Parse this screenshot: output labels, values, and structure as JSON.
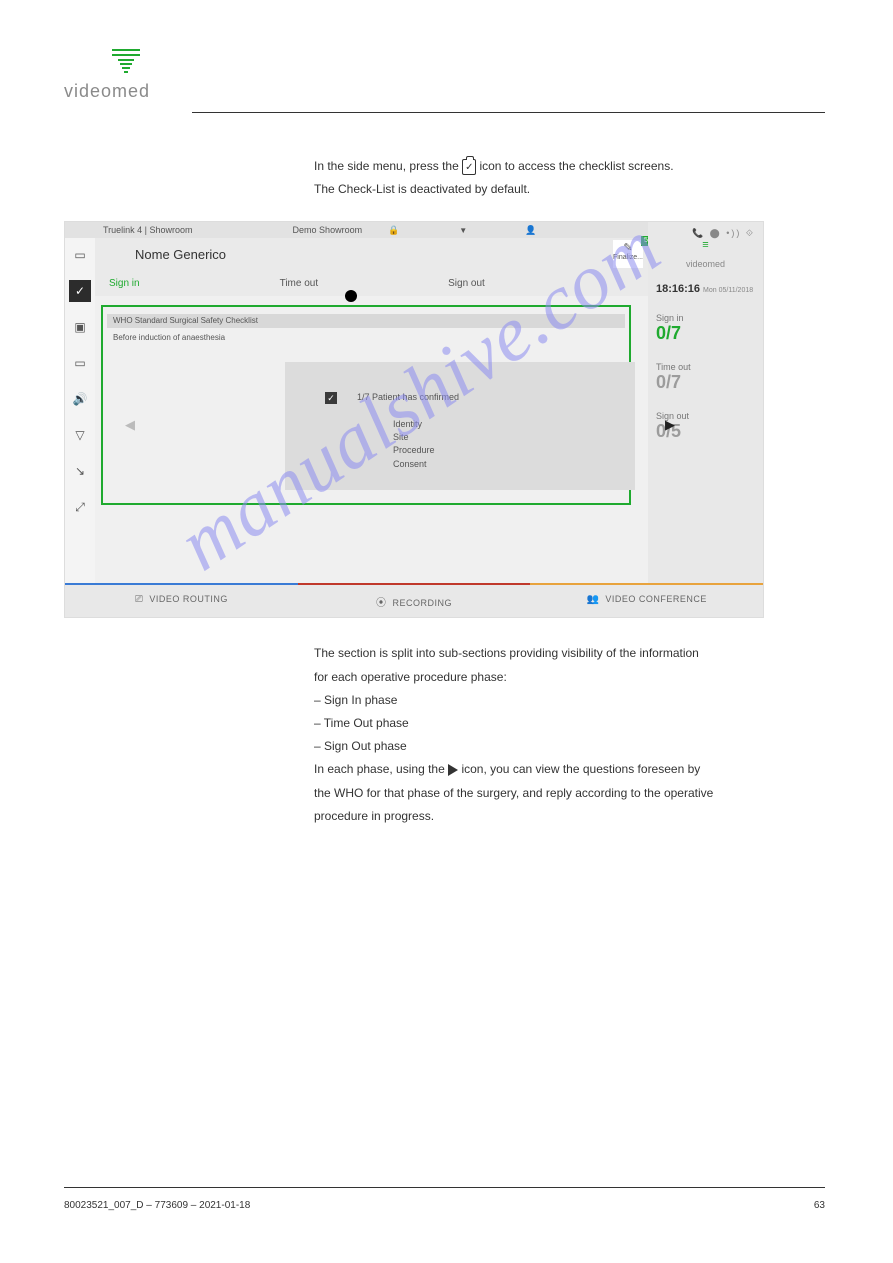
{
  "brand": "videomed",
  "intro": {
    "line1_a": "In the side menu, press the",
    "line1_b": "icon to access the checklist screens.",
    "line2": "The Check-List is deactivated by default."
  },
  "ui": {
    "top_bar": {
      "product": "Truelink 4 | Showroom",
      "demo": "Demo Showroom"
    },
    "patient_name": "Nome Generico",
    "finalize": "Finalize...",
    "finalize_badge": "5",
    "right": {
      "logo": "videomed",
      "time": "18:16:16",
      "date": "Mon 05/11/2018",
      "signin": {
        "label": "Sign in",
        "value": "0/7"
      },
      "timeout": {
        "label": "Time out",
        "value": "0/7"
      },
      "signout": {
        "label": "Sign out",
        "value": "0/5"
      }
    },
    "phases": {
      "p1": "Sign in",
      "p2": "Time out",
      "p3": "Sign out"
    },
    "checklist": {
      "title": "WHO Standard Surgical Safety Checklist",
      "subtitle": "Before induction of anaesthesia",
      "question": "1/7 Patient has confirmed",
      "items": [
        "Identity",
        "Site",
        "Procedure",
        "Consent"
      ]
    },
    "tabs": {
      "t1": "VIDEO ROUTING",
      "t2": "RECORDING",
      "t3": "VIDEO CONFERENCE"
    }
  },
  "below": {
    "p1": "The section is split into sub-sections providing visibility of the information",
    "p2": "for each operative procedure phase:",
    "bul1": "– Sign In phase",
    "bul2": "– Time Out phase",
    "bul3": "– Sign Out phase",
    "p3_a": "In each phase, using the",
    "p3_b": "icon, you can view the questions foreseen by",
    "p4": "the WHO for that phase of the surgery, and reply according to the operative",
    "p5": "procedure in progress."
  },
  "watermark": "manualshive.com",
  "footer": {
    "left": "80023521_007_D – 773609 – 2021-01-18",
    "right": "63"
  }
}
